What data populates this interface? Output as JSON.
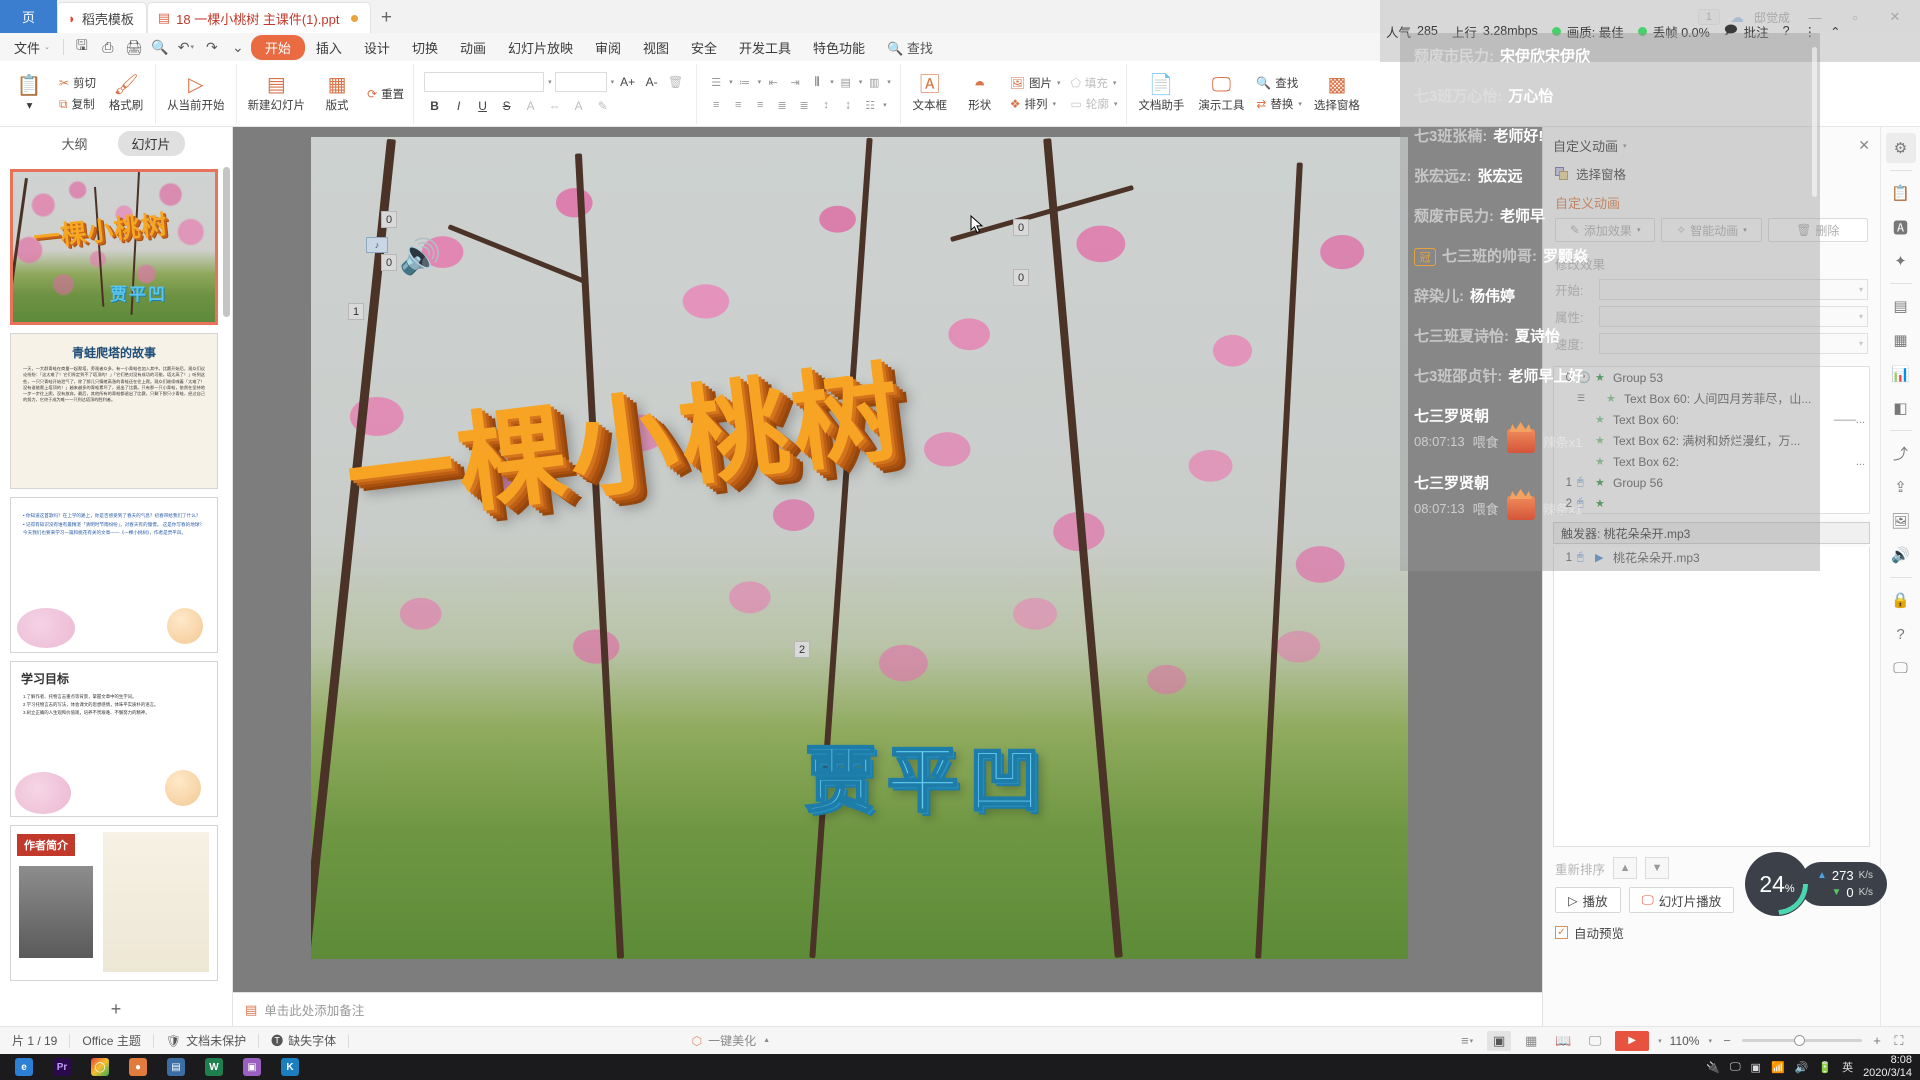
{
  "titlebar": {
    "home_label": "页",
    "tabs": [
      {
        "label": "稻壳模板",
        "icon": "wps-logo-icon",
        "active": false
      },
      {
        "label": "18  一棵小桃树  主课件(1).ppt",
        "icon": "ppt-file-icon",
        "active": true
      }
    ],
    "new_tab": "+",
    "badge": "1",
    "user": "邸觉成",
    "minimize": "—",
    "maximize": "▫",
    "close": "✕"
  },
  "menubar": {
    "file": "文件",
    "file_caret": "⌄",
    "quick_icons": [
      "save-icon",
      "print-preview-icon",
      "print-icon",
      "find-icon",
      "undo-icon",
      "redo-icon",
      "customize-icon"
    ],
    "items": [
      "开始",
      "插入",
      "设计",
      "切换",
      "动画",
      "幻灯片放映",
      "审阅",
      "视图",
      "安全",
      "开发工具",
      "特色功能"
    ],
    "active": "开始",
    "find": "查找"
  },
  "ribbon": {
    "clipboard": {
      "cut": "剪切",
      "copy": "复制",
      "paste": "粘贴",
      "format_painter": "格式刷"
    },
    "start_show": "从当前开始",
    "new_slide": "新建幻灯片",
    "layout": "版式",
    "reset": "重置",
    "font": {
      "name": "",
      "size": "",
      "grow": "A+",
      "shrink": "A-",
      "clear": "清除格式"
    },
    "bold": "B",
    "italic": "I",
    "underline": "U",
    "strike": "S",
    "text_box": "文本框",
    "shape": "形状",
    "picture": "图片",
    "arrange": "排列",
    "fill": "填充",
    "outline": "轮廓",
    "find": "查找",
    "replace": "替换",
    "select_pane": "选择窗格",
    "doc_assistant": "文档助手",
    "present_tools": "演示工具"
  },
  "left_panel": {
    "view_outline": "大纲",
    "view_slides": "幻灯片",
    "active_view": "幻灯片",
    "add_slide": "+",
    "thumbs": [
      {
        "n": 1,
        "kind": "title",
        "title": "一棵小桃树",
        "author": "贾平凹",
        "selected": true
      },
      {
        "n": 2,
        "kind": "text",
        "title": "青蛙爬塔的故事",
        "body": "一天，一大群青蛙在商量一起爬塔，旁观者众多，有一小青蛙也加入其中。比赛开始后，观众们议论纷纷：「这太难了！它们肯定到不了塔顶的！」「它们绝对没有成功的可能，塔太高了！」听到这些，一只只青蛙开始泄气了，除了那几只情绪高涨的青蛙还在往上爬。观众们继续喊着「太难了！没有谁能爬上塔顶的！」越来越多的青蛙累坏了，退出了比赛。只有那一只小青蛙，依然在坚持地一步一步往上爬，没有放弃。最后，其他所有的青蛙都退出了比赛，只剩下那只小青蛙，经过自己的努力，它终于成为唯一一只到达塔顶的胜利者。"
      },
      {
        "n": 3,
        "kind": "bullets",
        "lines": [
          "• 你知道这首歌吗？在上学的路上，你是否感受到了春天的气息？初春带给我们了什么？",
          "• 记得有知识没有谁有最精湛「清明时节雨纷纷」，对春天有的憧憬。 这是你写春的地球？今天我们也要来学习一篇和桃花有关的文章——《一棵小桃树》，作者是贾平凹。"
        ]
      },
      {
        "n": 4,
        "kind": "goal",
        "title": "学习目标",
        "body": "1.了解作者、托物言志重点等背景，掌握文章中的生字词。\n2.学习托物言志的写法，体会课文的思想感情，体味平实质朴的语言。\n3.树立正确的人生观和价值观，培养不畏艰难、不懈努力的精神。"
      },
      {
        "n": 5,
        "kind": "intro",
        "title": "作者简介"
      }
    ]
  },
  "slide": {
    "title": "一棵小桃树",
    "author": "贾平凹",
    "animation_badges": [
      "0",
      "0",
      "1",
      "0",
      "0",
      "2"
    ],
    "sound_icon": "speaker-icon"
  },
  "notes": {
    "placeholder": "单击此处添加备注",
    "icon": "notes-icon"
  },
  "anim_pane": {
    "title": "自定义动画",
    "title_caret": "▾",
    "close": "✕",
    "select_pane": "选择窗格",
    "section": "自定义动画",
    "add_effect": "添加效果",
    "smart_anim": "智能动画",
    "delete": "删除",
    "modify_effect": "修改效果",
    "fields": [
      {
        "label": "开始:",
        "value": ""
      },
      {
        "label": "属性:",
        "value": ""
      },
      {
        "label": "速度:",
        "value": ""
      }
    ],
    "items": [
      {
        "idx": "0",
        "mouse": "clock-icon",
        "star": "dark",
        "text": "Group 53",
        "tail": ""
      },
      {
        "idx": "",
        "mouse": "",
        "star": "light",
        "text": "Text Box 60: 人间四月芳菲尽，山...",
        "tail": "",
        "bars": "≡"
      },
      {
        "idx": "",
        "mouse": "",
        "star": "light",
        "text": "Text Box 60:",
        "tail": "——..."
      },
      {
        "idx": "",
        "mouse": "",
        "star": "light",
        "text": "Text Box 62: 满树和娇烂漫红，万...",
        "tail": ""
      },
      {
        "idx": "",
        "mouse": "",
        "star": "light",
        "text": "Text Box 62:",
        "tail": "..."
      },
      {
        "idx": "1",
        "mouse": "mouse-icon",
        "star": "dark",
        "text": "Group 56",
        "tail": ""
      },
      {
        "idx": "2",
        "mouse": "mouse-icon",
        "star": "dark",
        "text": "",
        "tail": ""
      }
    ],
    "trigger_header": "触发器: 桃花朵朵开.mp3",
    "trigger_items": [
      {
        "idx": "1",
        "mouse": "mouse-icon",
        "play": "▶",
        "text": "桃花朵朵开.mp3"
      }
    ],
    "reorder": "重新排序",
    "up": "▲",
    "down": "▼",
    "play": "播放",
    "slideshow": "幻灯片播放",
    "autopreview": "自动预览",
    "autopreview_checked": true
  },
  "icon_rail": [
    "settings-icon",
    "clipboard-icon",
    "text-effects-icon",
    "sparkle-icon",
    "table-icon",
    "grid-icon",
    "chart-icon",
    "shapes-icon",
    "export-icon",
    "share-icon",
    "image-icon",
    "audio-icon",
    "lock-icon",
    "help-icon",
    "monitor-icon"
  ],
  "statusbar": {
    "slide_count": "片 1 / 19",
    "theme": "Office 主题",
    "protection": "文档未保护",
    "font_missing": "缺失字体",
    "beautify": "一键美化",
    "beautify_caret": "▲",
    "view_buttons": [
      "outline-view-icon",
      "normal-view-icon",
      "slide-sorter-icon",
      "reading-view-icon",
      "presenter-view-icon"
    ],
    "active_view": "normal-view-icon",
    "play_button": "▶",
    "zoom_level": "110%",
    "zoom_out": "−",
    "zoom_in": "+",
    "fit_icon": "fit-slide-icon"
  },
  "taskbar": {
    "icons": [
      "edge-icon",
      "premiere-icon",
      "chrome-icon",
      "app-icon",
      "folder-icon",
      "wps-icon",
      "photo-icon",
      "kingsoft-icon"
    ],
    "tray_icons": [
      "usb-icon",
      "monitor-icon",
      "network-icon",
      "sound-icon",
      "battery-icon",
      "ime-icon"
    ],
    "ime": "英",
    "time": "8:08",
    "date": "2020/3/14"
  },
  "live": {
    "popularity_label": "人气",
    "popularity_value": "285",
    "uplink_label": "上行",
    "uplink_value": "3.28mbps",
    "quality_label": "画质: 最佳",
    "dropframe_label": "丢帧 0.0%",
    "comment": "批注",
    "help": "?",
    "more": "⋮",
    "collapse": "⌃"
  },
  "chat": {
    "messages": [
      {
        "user": "颓废市民力:",
        "msg": "宋伊欣宋伊欣",
        "type": "text"
      },
      {
        "user": "七3班万心怡:",
        "msg": "万心怡",
        "type": "text"
      },
      {
        "user": "七3班张楠:",
        "msg": "老师好!",
        "type": "text"
      },
      {
        "user": "张宏远z:",
        "msg": "张宏远",
        "type": "text"
      },
      {
        "user": "颓废市民力:",
        "msg": "老师早",
        "type": "text"
      },
      {
        "user": "七三班的帅哥:",
        "msg": "罗颢焱",
        "type": "text",
        "badge": "冠"
      },
      {
        "user": "辞染儿:",
        "msg": "杨伟婷",
        "type": "text"
      },
      {
        "user": "七三班夏诗怡:",
        "msg": "夏诗怡",
        "type": "text"
      },
      {
        "user": "七3班邵贞针:",
        "msg": "老师早上好",
        "type": "text"
      },
      {
        "user": "七三罗贤朝",
        "time": "08:07:13",
        "action": "喂食",
        "gift": "辣条x1",
        "type": "gift"
      },
      {
        "user": "七三罗贤朝",
        "time": "08:07:13",
        "action": "喂食",
        "gift": "辣条x1",
        "type": "gift"
      }
    ]
  },
  "speed_widget": {
    "percent": "24",
    "percent_sign": "%",
    "upload": "273",
    "upload_unit": "K/s",
    "download": "0",
    "download_unit": "K/s"
  }
}
